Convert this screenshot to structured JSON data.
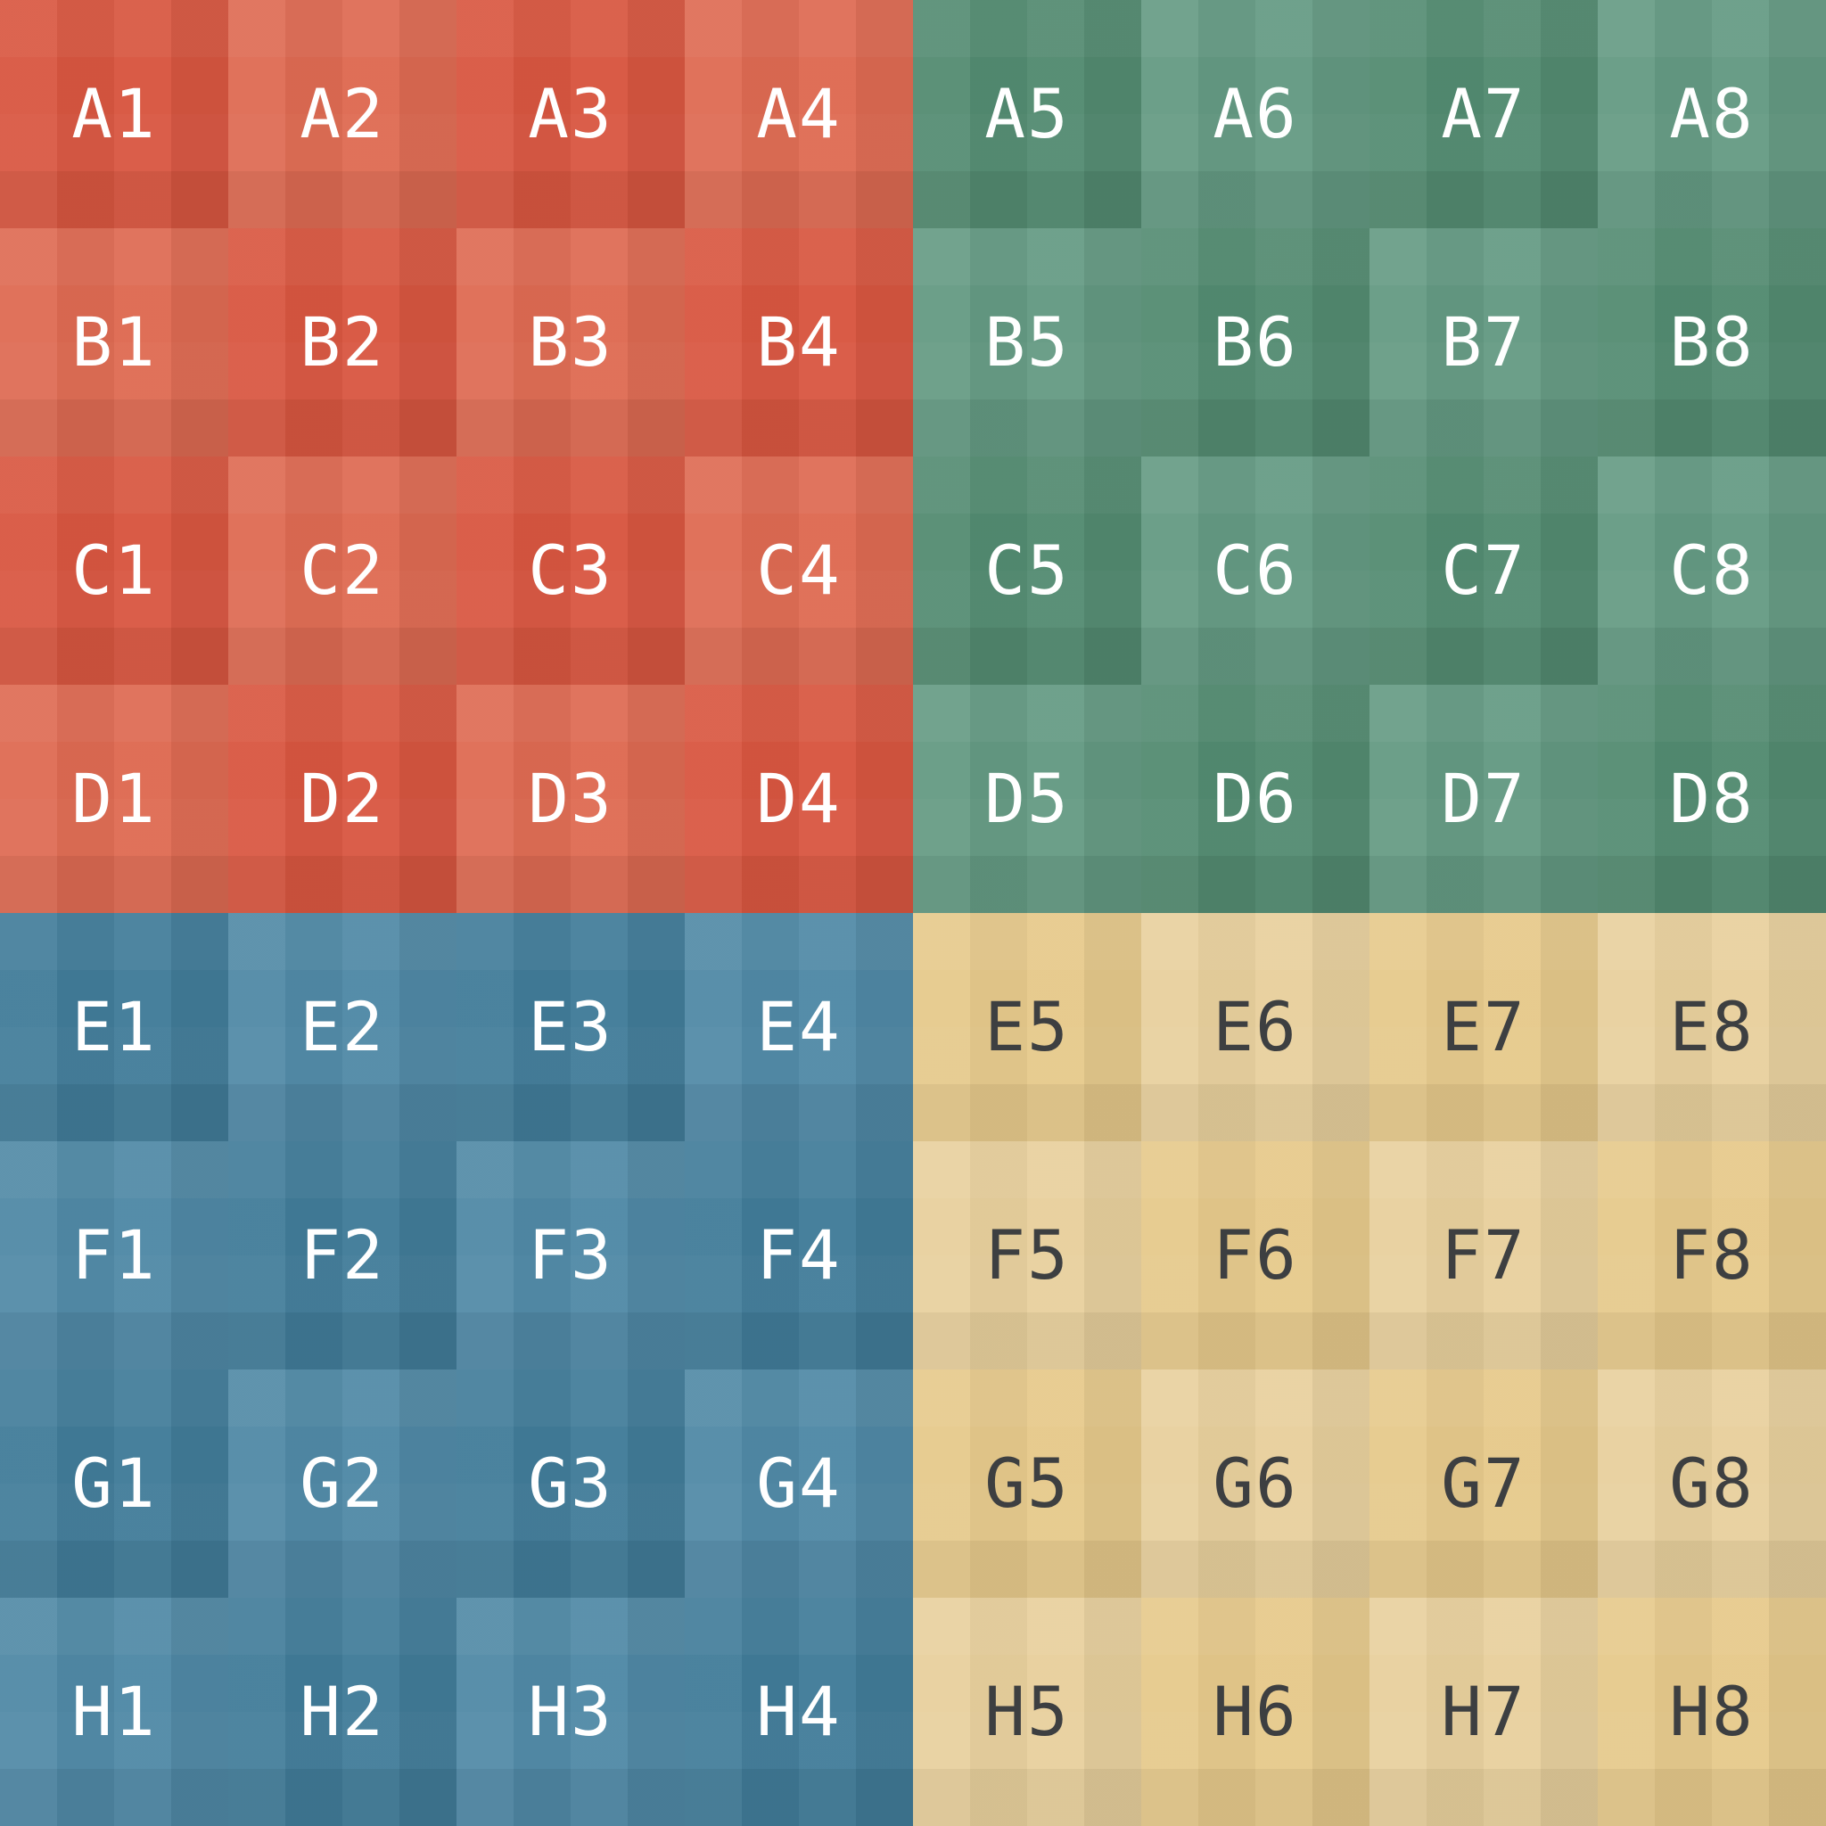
{
  "colors": {
    "red_light": "#de6a52",
    "red_dark": "#d85640",
    "green_light": "#649a83",
    "green_dark": "#538b71",
    "blue_light": "#5089a6",
    "blue_dark": "#417c99",
    "sand_light": "#e8d09d",
    "sand_dark": "#e6c98b",
    "text_light": "#ffffff",
    "text_dark": "#3d3f41"
  },
  "rows": [
    {
      "cells": [
        "A1",
        "A2",
        "A3",
        "A4",
        "A5",
        "A6",
        "A7",
        "A8"
      ]
    },
    {
      "cells": [
        "B1",
        "B2",
        "B3",
        "B4",
        "B5",
        "B6",
        "B7",
        "B8"
      ]
    },
    {
      "cells": [
        "C1",
        "C2",
        "C3",
        "C4",
        "C5",
        "C6",
        "C7",
        "C8"
      ]
    },
    {
      "cells": [
        "D1",
        "D2",
        "D3",
        "D4",
        "D5",
        "D6",
        "D7",
        "D8"
      ]
    },
    {
      "cells": [
        "E1",
        "E2",
        "E3",
        "E4",
        "E5",
        "E6",
        "E7",
        "E8"
      ]
    },
    {
      "cells": [
        "F1",
        "F2",
        "F3",
        "F4",
        "F5",
        "F6",
        "F7",
        "F8"
      ]
    },
    {
      "cells": [
        "G1",
        "G2",
        "G3",
        "G4",
        "G5",
        "G6",
        "G7",
        "G8"
      ]
    },
    {
      "cells": [
        "H1",
        "H2",
        "H3",
        "H4",
        "H5",
        "H6",
        "H7",
        "H8"
      ]
    }
  ]
}
